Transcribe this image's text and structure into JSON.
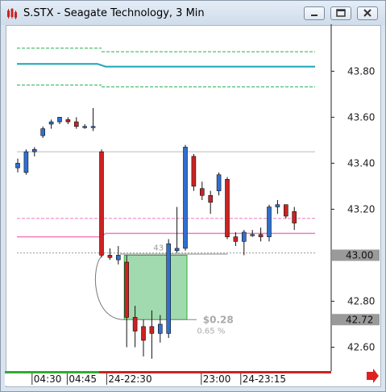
{
  "window": {
    "title": "S.STX - Seagate Technology, 3 Min",
    "buttons": [
      "minimize-icon",
      "restore-icon",
      "close-icon"
    ]
  },
  "colors": {
    "up": "#2f6fd0",
    "down": "#cc2222",
    "teal_line": "#1aa5b5",
    "green_dashed": "#22b050",
    "pink_line": "#f07cc0",
    "grey_line": "#bbbbbb",
    "box_fill": "#8fd4a0",
    "timeline_green": "#33aa33",
    "timeline_red": "#cc2222"
  },
  "chart_data": {
    "type": "candlestick",
    "ylim": [
      42.5,
      43.98
    ],
    "y_ticks": [
      "43.80",
      "43.60",
      "43.40",
      "43.20",
      "42.80",
      "42.60"
    ],
    "y_tick_values": [
      43.8,
      43.6,
      43.4,
      43.2,
      42.8,
      42.6
    ],
    "price_tags": [
      {
        "label": "43.00",
        "value": 43.0
      },
      {
        "label": "42.72",
        "value": 42.72
      }
    ],
    "x_labels": [
      "04:30",
      "04:45",
      "24-22:30",
      "23:00",
      "24-23:15"
    ],
    "candles": [
      {
        "o": 43.38,
        "h": 43.42,
        "l": 43.36,
        "c": 43.4
      },
      {
        "o": 43.36,
        "h": 43.46,
        "l": 43.35,
        "c": 43.45
      },
      {
        "o": 43.45,
        "h": 43.47,
        "l": 43.43,
        "c": 43.46
      },
      {
        "o": 43.52,
        "h": 43.56,
        "l": 43.51,
        "c": 43.55
      },
      {
        "o": 43.57,
        "h": 43.59,
        "l": 43.55,
        "c": 43.58
      },
      {
        "o": 43.58,
        "h": 43.6,
        "l": 43.57,
        "c": 43.6
      },
      {
        "o": 43.59,
        "h": 43.6,
        "l": 43.57,
        "c": 43.58
      },
      {
        "o": 43.58,
        "h": 43.6,
        "l": 43.55,
        "c": 43.56
      },
      {
        "o": 43.56,
        "h": 43.57,
        "l": 43.55,
        "c": 43.56
      },
      {
        "o": 43.56,
        "h": 43.64,
        "l": 43.54,
        "c": 43.56
      },
      {
        "o": 43.45,
        "h": 43.46,
        "l": 42.99,
        "c": 43.0
      },
      {
        "o": 43.0,
        "h": 43.03,
        "l": 42.98,
        "c": 42.99
      },
      {
        "o": 42.98,
        "h": 43.04,
        "l": 42.96,
        "c": 43.0
      },
      {
        "o": 42.97,
        "h": 43.0,
        "l": 42.6,
        "c": 42.73
      },
      {
        "o": 42.73,
        "h": 42.78,
        "l": 42.6,
        "c": 42.67
      },
      {
        "o": 42.69,
        "h": 42.72,
        "l": 42.56,
        "c": 42.63
      },
      {
        "o": 42.69,
        "h": 42.76,
        "l": 42.55,
        "c": 42.66
      },
      {
        "o": 42.66,
        "h": 42.74,
        "l": 42.62,
        "c": 42.7
      },
      {
        "o": 42.66,
        "h": 43.07,
        "l": 42.64,
        "c": 43.05
      },
      {
        "o": 43.02,
        "h": 43.21,
        "l": 43.01,
        "c": 43.03
      },
      {
        "o": 43.03,
        "h": 43.48,
        "l": 43.02,
        "c": 43.47
      },
      {
        "o": 43.43,
        "h": 43.44,
        "l": 43.28,
        "c": 43.3
      },
      {
        "o": 43.29,
        "h": 43.32,
        "l": 43.24,
        "c": 43.26
      },
      {
        "o": 43.26,
        "h": 43.28,
        "l": 43.18,
        "c": 43.23
      },
      {
        "o": 43.28,
        "h": 43.36,
        "l": 43.26,
        "c": 43.35
      },
      {
        "o": 43.33,
        "h": 43.34,
        "l": 43.07,
        "c": 43.08
      },
      {
        "o": 43.08,
        "h": 43.1,
        "l": 43.04,
        "c": 43.06
      },
      {
        "o": 43.06,
        "h": 43.11,
        "l": 43.0,
        "c": 43.1
      },
      {
        "o": 43.09,
        "h": 43.11,
        "l": 43.08,
        "c": 43.09
      },
      {
        "o": 43.09,
        "h": 43.12,
        "l": 43.06,
        "c": 43.08
      },
      {
        "o": 43.08,
        "h": 43.22,
        "l": 43.06,
        "c": 43.21
      },
      {
        "o": 43.21,
        "h": 43.24,
        "l": 43.18,
        "c": 43.22
      },
      {
        "o": 43.22,
        "h": 43.22,
        "l": 43.16,
        "c": 43.17
      },
      {
        "o": 43.19,
        "h": 43.21,
        "l": 43.11,
        "c": 43.14
      }
    ],
    "lines": {
      "teal_value_before": 43.832,
      "teal_value_after": 43.82,
      "green_dashed_upper": 43.9,
      "green_dashed_upper_after": 43.885,
      "green_dashed_lower": 43.74,
      "green_dashed_lower_after": 43.732,
      "grey_upper": 43.45,
      "grey_lower": 43.01,
      "pink_dashed": 43.16,
      "pink_solid_before": 43.08,
      "pink_solid_after": 43.095
    },
    "annotations": {
      "marker_label": "43",
      "gain_label": "$0.28",
      "pct_label": "0.65 %",
      "box_from": 43.0,
      "box_to": 42.72
    }
  }
}
